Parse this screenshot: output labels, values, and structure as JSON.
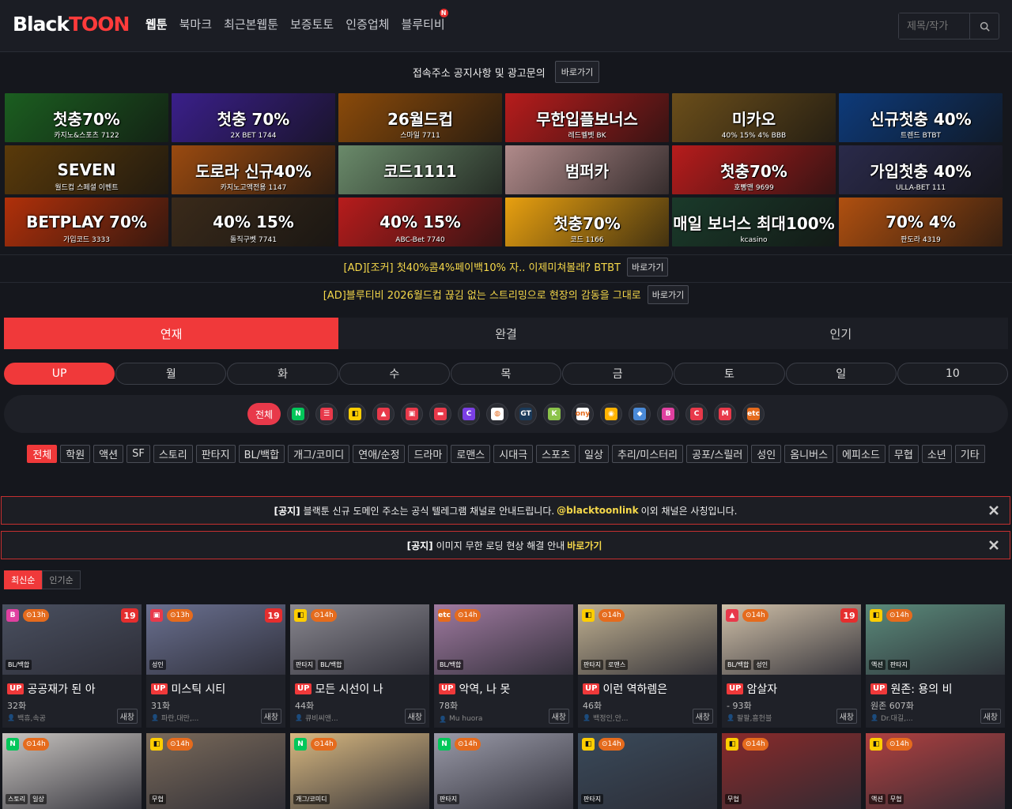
{
  "header": {
    "logo_black": "Black",
    "logo_red": "TOON",
    "nav": [
      {
        "label": "웹툰",
        "active": true
      },
      {
        "label": "북마크"
      },
      {
        "label": "최근본웹툰"
      },
      {
        "label": "보증토토"
      },
      {
        "label": "인증업체"
      },
      {
        "label": "블루티비",
        "badge": "N"
      }
    ],
    "search_placeholder": "제목/작가"
  },
  "noticebar": {
    "text": "접속주소 공지사항 및 광고문의",
    "button": "바로가기"
  },
  "banners": [
    {
      "title": "첫충70%",
      "sub": "카지노&스포츠 7122",
      "bg": "#1b5e20"
    },
    {
      "title": "첫충 70%",
      "sub": "2X BET 1744",
      "bg": "#3a1f8a"
    },
    {
      "title": "26월드컵",
      "sub": "스마일 7711",
      "bg": "#8a4a0a"
    },
    {
      "title": "무한입플보너스",
      "sub": "레드벨벳 BK",
      "bg": "#b71c1c"
    },
    {
      "title": "미카오",
      "sub": "40% 15% 4% BBB",
      "bg": "#6b4e1a"
    },
    {
      "title": "신규첫충 40%",
      "sub": "트렌드 BTBT",
      "bg": "#0d3a7a"
    },
    {
      "title": "SEVEN",
      "sub": "월드컵 스페셜 이벤트",
      "bg": "#5a3a0a"
    },
    {
      "title": "도로라 신규40%",
      "sub": "카지노고액전용 1147",
      "bg": "#9a4a10"
    },
    {
      "title": "코드1111",
      "sub": "",
      "bg": "#6a8a6a"
    },
    {
      "title": "범퍼카",
      "sub": "",
      "bg": "#b08a8a"
    },
    {
      "title": "첫충70%",
      "sub": "호빵맨 9699",
      "bg": "#b71c1c"
    },
    {
      "title": "가입첫충 40%",
      "sub": "ULLA-BET 111",
      "bg": "#2a2a4a"
    },
    {
      "title": "BETPLAY 70%",
      "sub": "가입코드 3333",
      "bg": "#b0300a"
    },
    {
      "title": "40% 15%",
      "sub": "돌직구벳 7741",
      "bg": "#3a2a1a"
    },
    {
      "title": "40% 15%",
      "sub": "ABC-Bet 7740",
      "bg": "#b71c1c"
    },
    {
      "title": "첫충70%",
      "sub": "코드 1166",
      "bg": "#e8a010"
    },
    {
      "title": "매일 보너스 최대100%",
      "sub": "kcasino",
      "bg": "#1a3a2a"
    },
    {
      "title": "70% 4%",
      "sub": "판도라 4319",
      "bg": "#b05010"
    }
  ],
  "ads": [
    {
      "text": "[AD][조커] 첫40%콤4%페이백10% 자.. 이제미쳐볼래? BTBT",
      "button": "바로가기"
    },
    {
      "text": "[AD]블루티비 2026월드컵 끊김 없는 스트리밍으로 현장의 감동을 그대로",
      "button": "바로가기"
    }
  ],
  "main_tabs": [
    {
      "label": "연재",
      "active": true
    },
    {
      "label": "완결"
    },
    {
      "label": "인기"
    }
  ],
  "day_tabs": [
    {
      "label": "UP",
      "active": true
    },
    {
      "label": "월"
    },
    {
      "label": "화"
    },
    {
      "label": "수"
    },
    {
      "label": "목"
    },
    {
      "label": "금"
    },
    {
      "label": "토"
    },
    {
      "label": "일"
    },
    {
      "label": "10"
    }
  ],
  "platforms": {
    "all_label": "전체",
    "icons": [
      {
        "name": "naver-icon",
        "text": "N",
        "color": "#03c75a"
      },
      {
        "name": "daum-icon",
        "text": "☰",
        "color": "#e8394a"
      },
      {
        "name": "kakaopage-icon",
        "text": "◧",
        "color": "#ffcd00"
      },
      {
        "name": "lezhin-icon",
        "text": "▲",
        "color": "#e8394a"
      },
      {
        "name": "toptoon-icon",
        "text": "▣",
        "color": "#e8394a"
      },
      {
        "name": "toomics-icon",
        "text": "▬",
        "color": "#e8394a"
      },
      {
        "name": "comica-icon",
        "text": "C",
        "color": "#7b3fe4"
      },
      {
        "name": "bomtoon-icon",
        "text": "◍",
        "color": "#ffffff"
      },
      {
        "name": "gt-icon",
        "text": "GT",
        "color": "#1a3a5a"
      },
      {
        "name": "kt-icon",
        "text": "K",
        "color": "#8bc34a"
      },
      {
        "name": "onyx-icon",
        "text": "ony",
        "color": "#ffffff"
      },
      {
        "name": "misterblue-icon",
        "text": "◉",
        "color": "#ffb300"
      },
      {
        "name": "bufftoon-icon",
        "text": "◆",
        "color": "#4a8ad8"
      },
      {
        "name": "bulb-icon",
        "text": "B",
        "color": "#e040a0"
      },
      {
        "name": "ridi-icon",
        "text": "C",
        "color": "#e8394a"
      },
      {
        "name": "mootoon-icon",
        "text": "M",
        "color": "#e8394a"
      },
      {
        "name": "etc-icon",
        "text": "etc",
        "color": "#e56b1d"
      }
    ]
  },
  "genres": [
    {
      "label": "전체",
      "active": true
    },
    {
      "label": "학원"
    },
    {
      "label": "액션"
    },
    {
      "label": "SF"
    },
    {
      "label": "스토리"
    },
    {
      "label": "판타지"
    },
    {
      "label": "BL/백합"
    },
    {
      "label": "개그/코미디"
    },
    {
      "label": "연애/순정"
    },
    {
      "label": "드라마"
    },
    {
      "label": "로맨스"
    },
    {
      "label": "시대극"
    },
    {
      "label": "스포츠"
    },
    {
      "label": "일상"
    },
    {
      "label": "추리/미스터리"
    },
    {
      "label": "공포/스릴러"
    },
    {
      "label": "성인"
    },
    {
      "label": "옴니버스"
    },
    {
      "label": "에피소드"
    },
    {
      "label": "무협"
    },
    {
      "label": "소년"
    },
    {
      "label": "기타"
    }
  ],
  "notices": [
    {
      "bold": "[공지]",
      "pre": "블랙툰 신규 도메인 주소는 공식 텔레그램 채널로 안내드립니다.",
      "highlight": "@blacktoonlink",
      "post": "이외 채널은 사칭입니다."
    },
    {
      "bold": "[공지]",
      "pre": "이미지 무한 로딩 현상 해결 안내",
      "highlight": "바로가기",
      "post": ""
    }
  ],
  "sort_tabs": [
    {
      "label": "최신순",
      "active": true
    },
    {
      "label": "인기순"
    }
  ],
  "cards": [
    {
      "plat": "B",
      "plat_color": "#e040a0",
      "time": "⊙13h",
      "age": "19",
      "tags": [
        "BL/백합"
      ],
      "up": "UP",
      "title": "공공재가 된 아",
      "eps": "32화",
      "author": "백휴,속공",
      "new": "새창",
      "art": "#4a5060"
    },
    {
      "plat": "▣",
      "plat_color": "#e8394a",
      "time": "⊙13h",
      "age": "19",
      "tags": [
        "성인"
      ],
      "up": "UP",
      "title": "미스틱 시티",
      "eps": "31화",
      "author": "파란,대만,...",
      "new": "새창",
      "art": "#6a7090"
    },
    {
      "plat": "◧",
      "plat_color": "#ffcd00",
      "time": "⊙14h",
      "age": "",
      "tags": [
        "판타지",
        "BL/백합"
      ],
      "up": "UP",
      "title": "모든 시선이 나",
      "eps": "44화",
      "author": "큐비씨앤...",
      "new": "새창",
      "art": "#8a8890"
    },
    {
      "plat": "etc",
      "plat_color": "#e56b1d",
      "time": "⊙14h",
      "age": "",
      "tags": [
        "BL/백합"
      ],
      "up": "UP",
      "title": "악역, 나 못",
      "eps": "78화",
      "author": "Mu huora",
      "new": "새창",
      "art": "#a07aa0"
    },
    {
      "plat": "◧",
      "plat_color": "#ffcd00",
      "time": "⊙14h",
      "age": "",
      "tags": [
        "판타지",
        "로맨스"
      ],
      "up": "UP",
      "title": "이런 역하렘은",
      "eps": "46화",
      "author": "백정인,안...",
      "new": "새창",
      "art": "#c0b090"
    },
    {
      "plat": "▲",
      "plat_color": "#e8394a",
      "time": "⊙14h",
      "age": "19",
      "tags": [
        "BL/백합",
        "성인"
      ],
      "up": "UP",
      "title": "암살자",
      "eps": "- 93화",
      "author": "팔팔,흠헌블",
      "new": "새창",
      "art": "#d0c0a8"
    },
    {
      "plat": "◧",
      "plat_color": "#ffcd00",
      "time": "⊙14h",
      "age": "",
      "tags": [
        "액션",
        "판타지"
      ],
      "up": "UP",
      "title": "원존: 용의 비",
      "eps": "원존 607화",
      "author": "Dr.대길,...",
      "new": "새창",
      "art": "#5a8a7a"
    }
  ],
  "cards2": [
    {
      "plat": "N",
      "plat_color": "#03c75a",
      "time": "⊙14h",
      "tags": [
        "스토리",
        "일상"
      ],
      "art": "#c8c4c0"
    },
    {
      "plat": "◧",
      "plat_color": "#ffcd00",
      "time": "⊙14h",
      "tags": [
        "무협"
      ],
      "art": "#7a6a5a"
    },
    {
      "plat": "N",
      "plat_color": "#03c75a",
      "time": "⊙14h",
      "tags": [
        "개그/코미디"
      ],
      "art": "#d8b880"
    },
    {
      "plat": "N",
      "plat_color": "#03c75a",
      "time": "⊙14h",
      "tags": [
        "판타지"
      ],
      "art": "#9a9aa8"
    },
    {
      "plat": "◧",
      "plat_color": "#ffcd00",
      "time": "⊙14h",
      "tags": [
        "판타지"
      ],
      "art": "#3a4a5a"
    },
    {
      "plat": "◧",
      "plat_color": "#ffcd00",
      "time": "⊙14h",
      "tags": [
        "무협"
      ],
      "art": "#8a2a2a"
    },
    {
      "plat": "◧",
      "plat_color": "#ffcd00",
      "time": "⊙14h",
      "tags": [
        "액션",
        "무협"
      ],
      "art": "#b04040"
    }
  ]
}
